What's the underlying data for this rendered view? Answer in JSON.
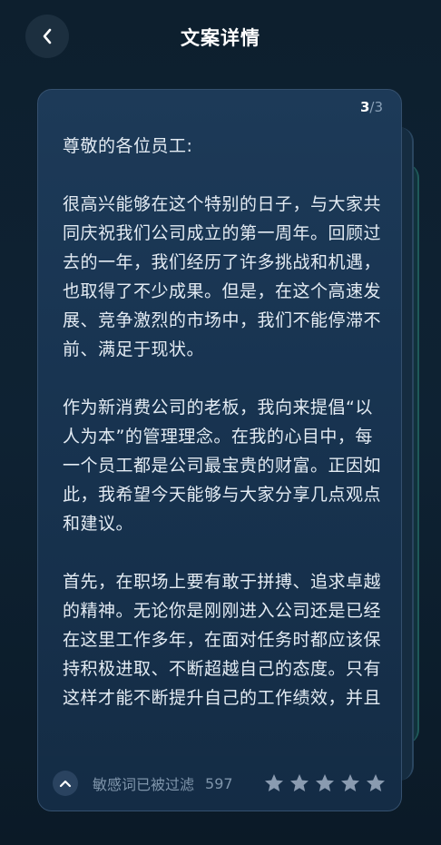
{
  "header": {
    "title": "文案详情"
  },
  "card": {
    "page_current": "3",
    "page_sep": "/",
    "page_total": "3",
    "paragraphs": [
      "尊敬的各位员工:",
      "很高兴能够在这个特别的日子，与大家共同庆祝我们公司成立的第一周年。回顾过去的一年，我们经历了许多挑战和机遇，也取得了不少成果。但是，在这个高速发展、竞争激烈的市场中，我们不能停滞不前、满足于现状。",
      "作为新消费公司的老板，我向来提倡“以人为本”的管理理念。在我的心目中，每一个员工都是公司最宝贵的财富。正因如此，我希望今天能够与大家分享几点观点和建议。",
      "首先，在职场上要有敢于拼搏、追求卓越的精神。无论你是刚刚进入公司还是已经在这里工作多年，在面对任务时都应该保持积极进取、不断超越自己的态度。只有这样才能不断提升自己的工作绩效，并且"
    ],
    "footer": {
      "filter_text": "敏感词已被过滤",
      "word_count": "597",
      "rating_stars": 5,
      "star_color": "#8a9bb0"
    }
  },
  "colors": {
    "background": "#0d1f2e",
    "card": "#1a3653",
    "text": "#e3ebf3",
    "muted": "#7f95ab"
  },
  "icons": {
    "back": "chevron-left-icon",
    "collapse": "chevron-up-icon",
    "star": "star-icon"
  }
}
